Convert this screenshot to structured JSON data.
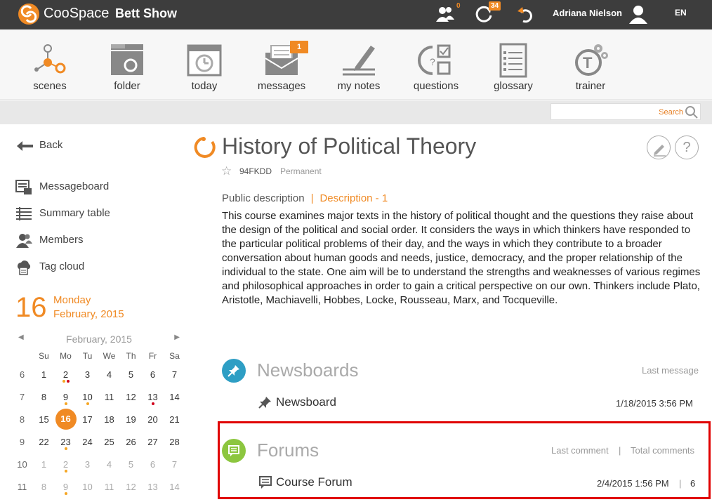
{
  "topbar": {
    "brand": "CooSpace",
    "course": "Bett Show",
    "members_badge": "0",
    "updates_badge": "34",
    "user_name": "Adriana Nielson",
    "language": "EN"
  },
  "toolbar": {
    "items": [
      {
        "label": "scenes",
        "icon": "scenes-icon"
      },
      {
        "label": "folder",
        "icon": "folder-icon"
      },
      {
        "label": "today",
        "icon": "today-icon"
      },
      {
        "label": "messages",
        "icon": "messages-icon",
        "badge": "1"
      },
      {
        "label": "my notes",
        "icon": "notes-icon"
      },
      {
        "label": "questions",
        "icon": "questions-icon"
      },
      {
        "label": "glossary",
        "icon": "glossary-icon"
      },
      {
        "label": "trainer",
        "icon": "trainer-icon"
      }
    ]
  },
  "search": {
    "placeholder": "Search"
  },
  "sidebar": {
    "back": "Back",
    "items": [
      {
        "label": "Messageboard",
        "icon": "messageboard-icon"
      },
      {
        "label": "Summary table",
        "icon": "summary-table-icon"
      },
      {
        "label": "Members",
        "icon": "members-icon"
      },
      {
        "label": "Tag cloud",
        "icon": "tag-cloud-icon"
      }
    ]
  },
  "date": {
    "day_number": "16",
    "weekday": "Monday",
    "month_year": "February, 2015"
  },
  "calendar": {
    "title": "February, 2015",
    "weekdays": [
      "Su",
      "Mo",
      "Tu",
      "We",
      "Th",
      "Fr",
      "Sa"
    ],
    "weeks": [
      {
        "wk": "6",
        "days": [
          "1",
          "2",
          "3",
          "4",
          "5",
          "6",
          "7"
        ]
      },
      {
        "wk": "7",
        "days": [
          "8",
          "9",
          "10",
          "11",
          "12",
          "13",
          "14"
        ]
      },
      {
        "wk": "8",
        "days": [
          "15",
          "16",
          "17",
          "18",
          "19",
          "20",
          "21"
        ]
      },
      {
        "wk": "9",
        "days": [
          "22",
          "23",
          "24",
          "25",
          "26",
          "27",
          "28"
        ]
      },
      {
        "wk": "10",
        "days": [
          "1",
          "2",
          "3",
          "4",
          "5",
          "6",
          "7"
        ]
      },
      {
        "wk": "11",
        "days": [
          "8",
          "9",
          "10",
          "11",
          "12",
          "13",
          "14"
        ]
      }
    ],
    "today": "16",
    "colors": {
      "accent": "#f08a24",
      "dot_orange": "#f5a623",
      "dot_red": "#d0021b"
    }
  },
  "course": {
    "title": "History of Political Theory",
    "code": "94FKDD",
    "status": "Permanent",
    "tab_public": "Public description",
    "tab_separator": "|",
    "tab_description": "Description - 1",
    "description": "This course examines major texts in the history of political thought and the questions they raise about the design of the political and social order. It considers the ways in which thinkers have responded to the particular political problems of their day, and the ways in which they contribute to a broader conversation about human goods and needs, justice, democracy, and the proper relationship of the individual to the state. One aim will be to understand the strengths and weaknesses of various regimes and philosophical approaches in order to gain a critical perspective on our own. Thinkers include Plato, Aristotle, Machiavelli, Hobbes, Locke, Rousseau, Marx, and Tocqueville."
  },
  "newsboards": {
    "title": "Newsboards",
    "meta": "Last message",
    "row_name": "Newsboard",
    "row_last": "1/18/2015 3:56 PM",
    "color": "#2e9ec4"
  },
  "forums": {
    "title": "Forums",
    "meta_last": "Last comment",
    "meta_sep": "|",
    "meta_total": "Total comments",
    "row_name": "Course Forum",
    "row_last": "2/4/2015 1:56 PM",
    "row_sep": "|",
    "row_total": "6",
    "color": "#8cc63f"
  }
}
